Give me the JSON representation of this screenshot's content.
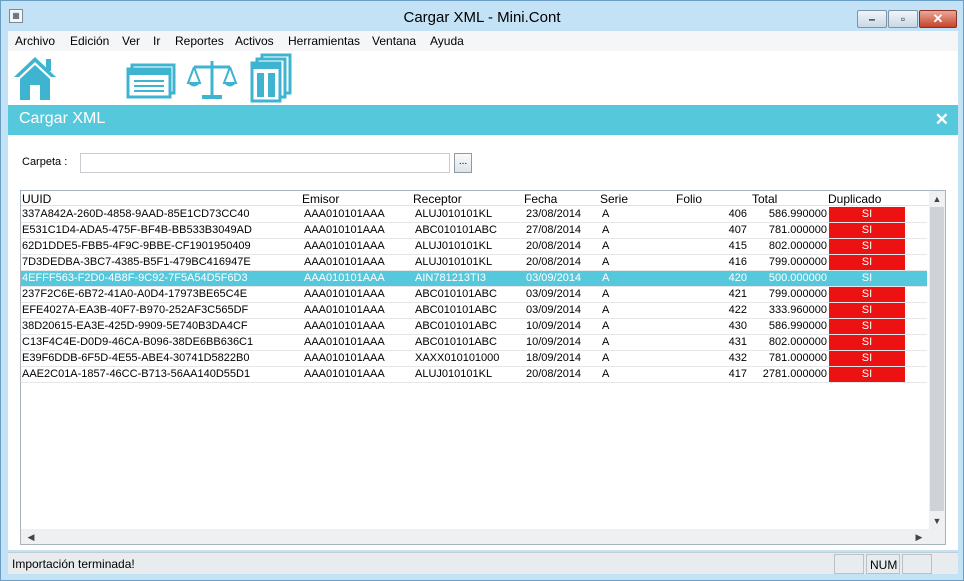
{
  "window": {
    "title": "Cargar XML - Mini.Cont",
    "minimize_glyph": "–",
    "maximize_glyph": "▫",
    "close_glyph": "✕"
  },
  "menu": [
    "Archivo",
    "Edición",
    "Ver",
    "Ir",
    "Reportes",
    "Activos",
    "Herramientas",
    "Ventana",
    "Ayuda"
  ],
  "toolbar": {
    "icons": [
      "home-icon",
      "window-list-icon",
      "balance-scale-icon",
      "documents-icon"
    ],
    "icon_color": "#3fb4d1"
  },
  "panel": {
    "title": "Cargar XML",
    "close_glyph": "✕",
    "accent_color": "#56c8dc"
  },
  "form": {
    "folder_label": "Carpeta :",
    "folder_value": "",
    "browse_label": "..."
  },
  "grid": {
    "columns": [
      "UUID",
      "Emisor",
      "Receptor",
      "Fecha",
      "Serie",
      "Folio",
      "Total",
      "Duplicado"
    ],
    "selected_index": 4,
    "duplicate_color": "#ee1111",
    "rows": [
      {
        "uuid": "337A842A-260D-4858-9AAD-85E1CD73CC40",
        "emisor": "AAA010101AAA",
        "receptor": "ALUJ010101KL",
        "fecha": "23/08/2014",
        "serie": "A",
        "folio": "406",
        "total": "586.990000",
        "dup": "SI"
      },
      {
        "uuid": "E531C1D4-ADA5-475F-BF4B-BB533B3049AD",
        "emisor": "AAA010101AAA",
        "receptor": "ABC010101ABC",
        "fecha": "27/08/2014",
        "serie": "A",
        "folio": "407",
        "total": "781.000000",
        "dup": "SI"
      },
      {
        "uuid": "62D1DDE5-FBB5-4F9C-9BBE-CF1901950409",
        "emisor": "AAA010101AAA",
        "receptor": "ALUJ010101KL",
        "fecha": "20/08/2014",
        "serie": "A",
        "folio": "415",
        "total": "802.000000",
        "dup": "SI"
      },
      {
        "uuid": "7D3DEDBA-3BC7-4385-B5F1-479BC416947E",
        "emisor": "AAA010101AAA",
        "receptor": "ALUJ010101KL",
        "fecha": "20/08/2014",
        "serie": "A",
        "folio": "416",
        "total": "799.000000",
        "dup": "SI"
      },
      {
        "uuid": "4EFFF563-F2D0-4B8F-9C92-7F5A54D5F6D3",
        "emisor": "AAA010101AAA",
        "receptor": "AIN781213TI3",
        "fecha": "03/09/2014",
        "serie": "A",
        "folio": "420",
        "total": "500.000000",
        "dup": "SI"
      },
      {
        "uuid": "237F2C6E-6B72-41A0-A0D4-17973BE65C4E",
        "emisor": "AAA010101AAA",
        "receptor": "ABC010101ABC",
        "fecha": "03/09/2014",
        "serie": "A",
        "folio": "421",
        "total": "799.000000",
        "dup": "SI"
      },
      {
        "uuid": "EFE4027A-EA3B-40F7-B970-252AF3C565DF",
        "emisor": "AAA010101AAA",
        "receptor": "ABC010101ABC",
        "fecha": "03/09/2014",
        "serie": "A",
        "folio": "422",
        "total": "333.960000",
        "dup": "SI"
      },
      {
        "uuid": "38D20615-EA3E-425D-9909-5E740B3DA4CF",
        "emisor": "AAA010101AAA",
        "receptor": "ABC010101ABC",
        "fecha": "10/09/2014",
        "serie": "A",
        "folio": "430",
        "total": "586.990000",
        "dup": "SI"
      },
      {
        "uuid": "C13F4C4E-D0D9-46CA-B096-38DE6BB636C1",
        "emisor": "AAA010101AAA",
        "receptor": "ABC010101ABC",
        "fecha": "10/09/2014",
        "serie": "A",
        "folio": "431",
        "total": "802.000000",
        "dup": "SI"
      },
      {
        "uuid": "E39F6DDB-6F5D-4E55-ABE4-30741D5822B0",
        "emisor": "AAA010101AAA",
        "receptor": "XAXX010101000",
        "fecha": "18/09/2014",
        "serie": "A",
        "folio": "432",
        "total": "781.000000",
        "dup": "SI"
      },
      {
        "uuid": "AAE2C01A-1857-46CC-B713-56AA140D55D1",
        "emisor": "AAA010101AAA",
        "receptor": "ALUJ010101KL",
        "fecha": "20/08/2014",
        "serie": "A",
        "folio": "417",
        "total": "2781.000000",
        "dup": "SI"
      }
    ]
  },
  "statusbar": {
    "message": "Importación terminada!",
    "num_indicator": "NUM"
  }
}
